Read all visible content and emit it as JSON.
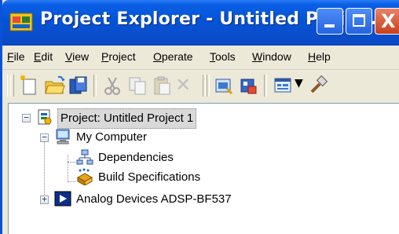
{
  "window": {
    "title": "Project Explorer - Untitled Proje...",
    "controls": {
      "minimize": "_",
      "maximize": "□",
      "close": "X"
    }
  },
  "menu": {
    "items": [
      {
        "label": "File",
        "mnemonic": "F",
        "rest": "ile"
      },
      {
        "label": "Edit",
        "mnemonic": "E",
        "rest": "dit"
      },
      {
        "label": "View",
        "mnemonic": "V",
        "rest": "iew"
      },
      {
        "label": "Project",
        "mnemonic": "P",
        "rest": "roject"
      },
      {
        "label": "Operate",
        "mnemonic": "O",
        "rest": "perate"
      },
      {
        "label": "Tools",
        "mnemonic": "T",
        "rest": "ools"
      },
      {
        "label": "Window",
        "mnemonic": "W",
        "rest": "indow"
      },
      {
        "label": "Help",
        "mnemonic": "H",
        "rest": "elp"
      }
    ]
  },
  "toolbar": {
    "icons": [
      "new-file-icon",
      "open-folder-icon",
      "save-all-icon",
      "cut-icon",
      "copy-icon",
      "paste-icon",
      "delete-icon",
      "build-icon",
      "deploy-icon",
      "view-icon",
      "dropdown-arrow-icon",
      "tool-icon"
    ]
  },
  "tree": {
    "root": {
      "label": "Project: Untitled Project 1",
      "expander": "−"
    },
    "my_computer": {
      "label": "My Computer",
      "expander": "−"
    },
    "dependencies": {
      "label": "Dependencies"
    },
    "build_specifications": {
      "label": "Build Specifications"
    },
    "target": {
      "label": "Analog Devices ADSP-BF537",
      "expander": "+"
    }
  },
  "colors": {
    "titlebar": "#0453d6",
    "chrome": "#ece9d8",
    "close_button": "#c8401c",
    "selection": "#d9d9d9"
  }
}
